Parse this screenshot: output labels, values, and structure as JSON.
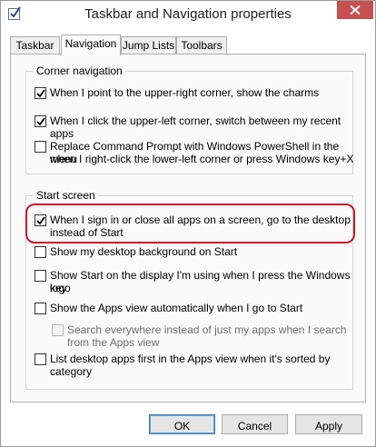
{
  "window": {
    "title": "Taskbar and Navigation properties"
  },
  "tabs": [
    {
      "label": "Taskbar",
      "active": false
    },
    {
      "label": "Navigation",
      "active": true
    },
    {
      "label": "Jump Lists",
      "active": false
    },
    {
      "label": "Toolbars",
      "active": false
    }
  ],
  "corner_navigation": {
    "title": "Corner navigation",
    "options": [
      {
        "lines": [
          "When I point to the upper-right corner, show the charms"
        ],
        "checked": true,
        "enabled": true
      },
      {
        "lines": [
          "When I click the upper-left corner, switch between my recent apps"
        ],
        "checked": true,
        "enabled": true
      },
      {
        "lines": [
          "Replace Command Prompt with Windows PowerShell in the menu",
          "when I right-click the lower-left corner or press Windows key+X"
        ],
        "checked": false,
        "enabled": true
      }
    ]
  },
  "start_screen": {
    "title": "Start screen",
    "options": [
      {
        "lines": [
          "When I sign in or close all apps on a screen, go to the desktop",
          "instead of Start"
        ],
        "checked": true,
        "enabled": true
      },
      {
        "lines": [
          "Show my desktop background on Start"
        ],
        "checked": false,
        "enabled": true
      },
      {
        "lines": [
          "Show Start on the display I'm using when I press the Windows logo",
          "key"
        ],
        "checked": false,
        "enabled": true
      },
      {
        "lines": [
          "Show the Apps view automatically when I go to Start"
        ],
        "checked": false,
        "enabled": true
      },
      {
        "lines": [
          "Search everywhere instead of just my apps when I search",
          "from the Apps view"
        ],
        "checked": false,
        "enabled": false
      },
      {
        "lines": [
          "List desktop apps first in the Apps view when it's sorted by",
          "category"
        ],
        "checked": false,
        "enabled": true
      }
    ]
  },
  "buttons": {
    "ok": "OK",
    "cancel": "Cancel",
    "apply": "Apply"
  },
  "colors": {
    "highlight": "#d0122a",
    "close_button": "#c75050"
  },
  "icons": {
    "title": "checkbox-properties-icon",
    "close": "close-icon",
    "check": "checkmark-icon"
  }
}
